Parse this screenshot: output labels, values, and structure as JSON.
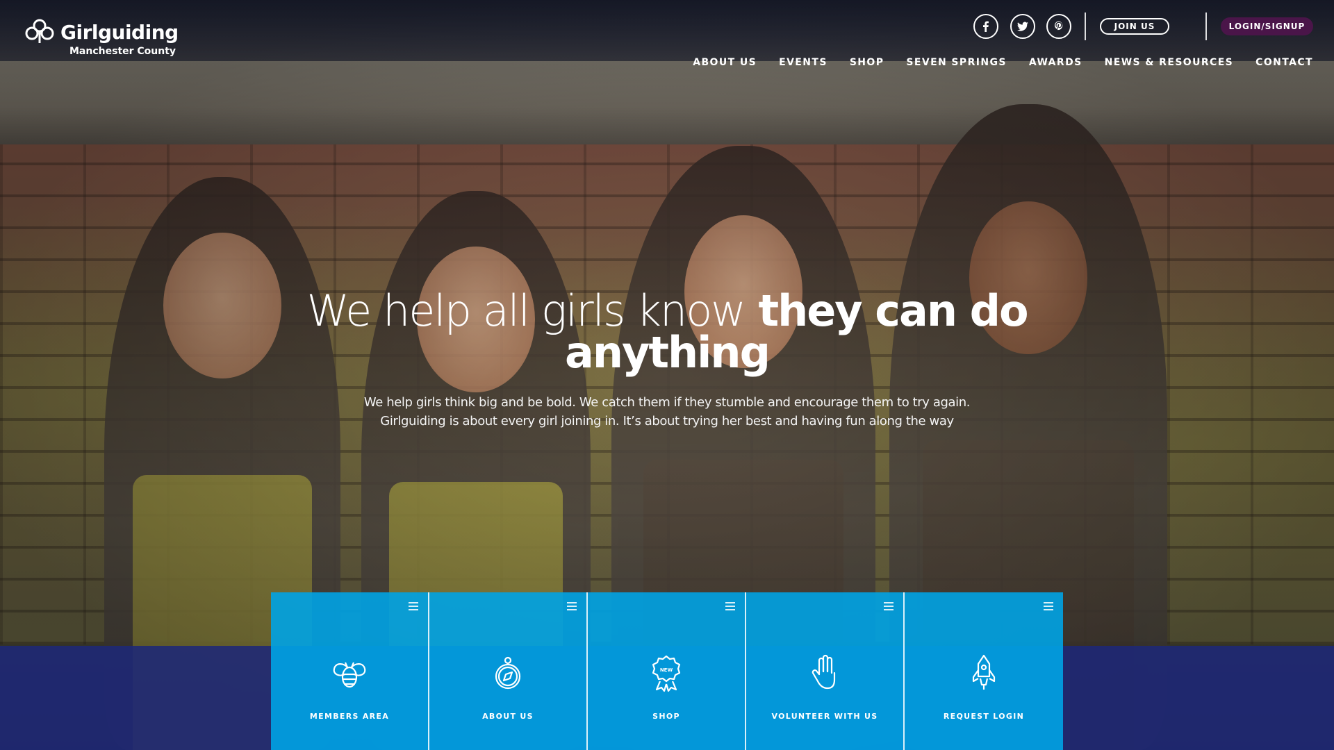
{
  "brand": {
    "title": "Girlguiding",
    "subtitle": "Manchester County"
  },
  "header": {
    "social": [
      {
        "name": "facebook-icon"
      },
      {
        "name": "twitter-icon"
      },
      {
        "name": "pinterest-icon"
      }
    ],
    "join_label": "JOIN US",
    "login_label": "LOGIN/SIGNUP"
  },
  "nav": {
    "items": [
      {
        "label": "ABOUT US"
      },
      {
        "label": "EVENTS"
      },
      {
        "label": "SHOP"
      },
      {
        "label": "SEVEN SPRINGS"
      },
      {
        "label": "AWARDS"
      },
      {
        "label": "NEWS & RESOURCES"
      },
      {
        "label": "CONTACT"
      }
    ]
  },
  "hero": {
    "headline_light": "We help all girls know",
    "headline_bold": "they can do anything",
    "subtext_line1": "We help girls think big and be bold. We catch them if they stumble and encourage them to try again.",
    "subtext_line2": "Girlguiding is about every girl joining in. It’s about trying her best and having fun along the way"
  },
  "tiles": [
    {
      "label": "MEMBERS AREA",
      "icon": "bee-icon"
    },
    {
      "label": "ABOUT US",
      "icon": "compass-icon"
    },
    {
      "label": "SHOP",
      "icon": "new-badge-icon"
    },
    {
      "label": "VOLUNTEER WITH US",
      "icon": "raised-hand-icon"
    },
    {
      "label": "REQUEST LOGIN",
      "icon": "rocket-icon"
    }
  ],
  "colors": {
    "tile_blue": "#00a3e4",
    "band_navy": "#1e2878",
    "login_purple": "#4a1549"
  }
}
